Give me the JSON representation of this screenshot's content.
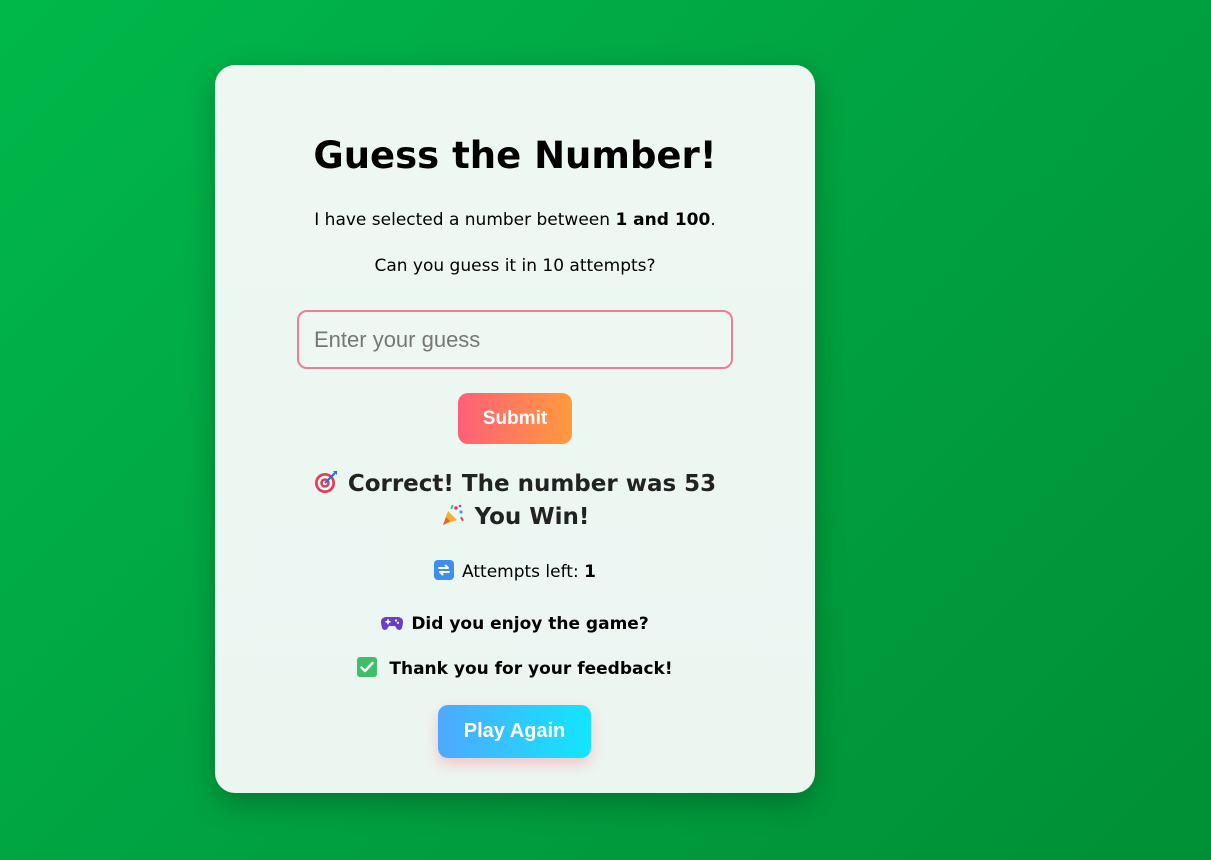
{
  "game": {
    "title": "Guess the Number!",
    "intro_prefix": "I have selected a number between ",
    "intro_range": "1 and 100",
    "intro_suffix": ".",
    "attempts_question": "Can you guess it in 10 attempts?",
    "input_placeholder": "Enter your guess",
    "submit_label": "Submit",
    "result_line1": "Correct! The number was 53",
    "result_line2": "You Win!",
    "attempts_label": "Attempts left: ",
    "attempts_left": "1",
    "feedback_question": "Did you enjoy the game?",
    "feedback_thanks": "Thank you for your feedback!",
    "play_again_label": "Play Again"
  },
  "icons": {
    "target": "target-icon",
    "party": "party-popper-icon",
    "repeat": "repeat-icon",
    "gamepad": "gamepad-icon",
    "check": "check-mark-icon"
  },
  "colors": {
    "background": "#00a040",
    "input_border": "#f07c97",
    "submit_gradient_start": "#ff5f79",
    "submit_gradient_end": "#ff9a3c",
    "play_gradient_start": "#4fa8ff",
    "play_gradient_end": "#12e6ff"
  }
}
